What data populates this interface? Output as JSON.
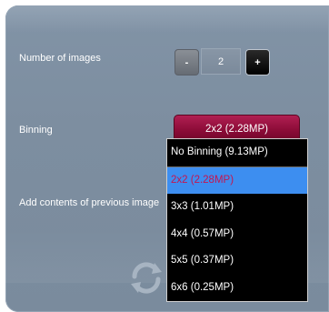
{
  "settings": {
    "num_images": {
      "label": "Number of images",
      "minus_label": "-",
      "value": "2",
      "plus_label": "+"
    },
    "binning": {
      "label": "Binning",
      "selected": "2x2 (2.28MP)",
      "options": [
        "No Binning (9.13MP)",
        "2x2 (2.28MP)",
        "3x3 (1.01MP)",
        "4x4 (0.57MP)",
        "5x5 (0.37MP)",
        "6x6 (0.25MP)"
      ]
    },
    "add_contents": {
      "label": "Add contents of previous image"
    },
    "refresh_icon": "refresh-icon"
  },
  "colors": {
    "panel": "#7d8ea0",
    "select_accent": "#8c0c38",
    "highlight": "#3d8ef0",
    "highlight_text": "#c5154f"
  }
}
